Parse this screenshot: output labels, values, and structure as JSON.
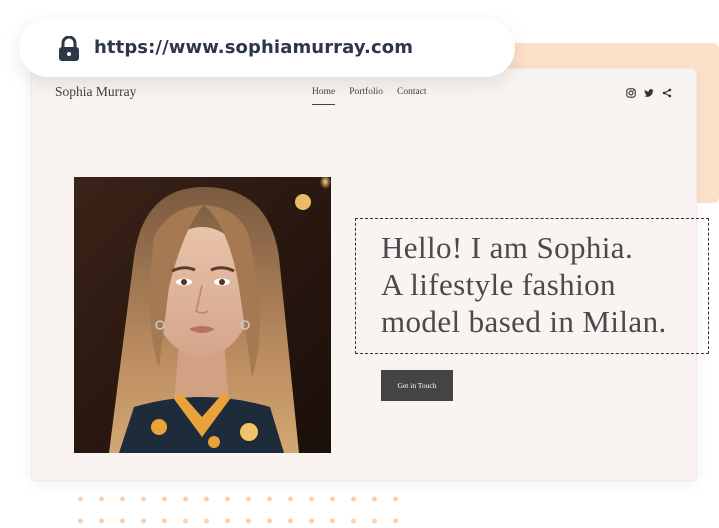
{
  "browser": {
    "url": "https://www.sophiamurray.com",
    "lock_icon": "lock-icon"
  },
  "site": {
    "brand": "Sophia Murray",
    "nav": [
      "Home",
      "Portfolio",
      "Contact"
    ],
    "social_icons": [
      "instagram-icon",
      "twitter-icon",
      "share-icon"
    ],
    "hero": {
      "headline_lines": [
        "Hello! I am Sophia.",
        "A lifestyle fashion",
        "model based in Milan."
      ],
      "cta_label": "Get in Touch"
    }
  },
  "colors": {
    "peach": "#fde0c8",
    "page_bg": "#f9f3f2",
    "button": "#444444",
    "text": "#4a4a4a",
    "url_text": "#2d3748"
  }
}
